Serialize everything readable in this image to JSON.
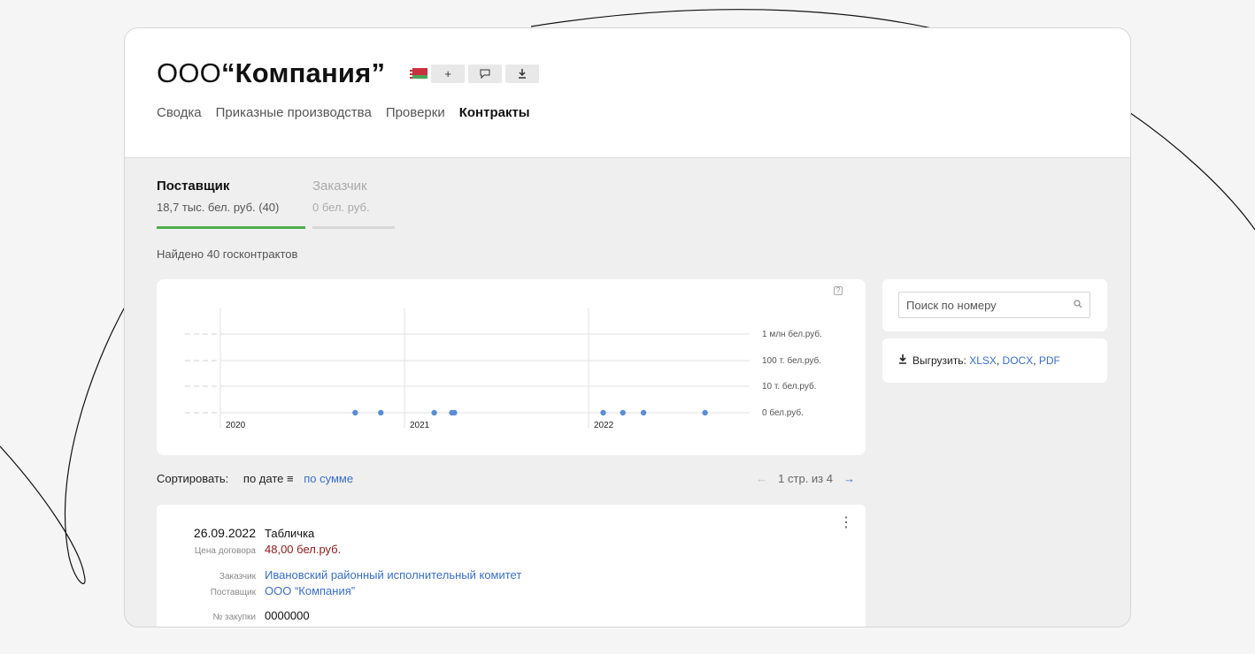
{
  "header": {
    "title_prefix": "ООО",
    "title_name": "“Компания”",
    "flag_icon": "belarus-flag-icon",
    "toolbar": {
      "add_label": "+",
      "comment_label": "💬",
      "download_label": "⤓"
    }
  },
  "nav": {
    "tabs": [
      {
        "label": "Сводка"
      },
      {
        "label": "Приказные производства"
      },
      {
        "label": "Проверки"
      },
      {
        "label": "Контракты"
      }
    ],
    "active": "Контракты"
  },
  "role_tabs": [
    {
      "name": "Поставщик",
      "sum": "18,7 тыс. бел. руб. (40)"
    },
    {
      "name": "Заказчик",
      "sum": "0 бел. руб."
    }
  ],
  "found_text": "Найдено 40 госконтрактов",
  "chart_data": {
    "type": "scatter",
    "y_scale": "log",
    "y_ticks": [
      "1 млн бел.руб.",
      "100 т. бел.руб.",
      "10 т. бел.руб.",
      "0 бел.руб."
    ],
    "x_ticks": [
      "2020",
      "2021",
      "2022"
    ],
    "points": [
      {
        "x": "2020-09-25",
        "y": 0
      },
      {
        "x": "2020-11-15",
        "y": 0
      },
      {
        "x": "2021-03-01",
        "y": 0
      },
      {
        "x": "2021-04-05",
        "y": 0
      },
      {
        "x": "2021-04-10",
        "y": 0
      },
      {
        "x": "2022-01-30",
        "y": 0
      },
      {
        "x": "2022-03-10",
        "y": 0
      },
      {
        "x": "2022-04-20",
        "y": 0
      },
      {
        "x": "2022-08-20",
        "y": 0
      }
    ],
    "marker_color": "#5b8dd6"
  },
  "search": {
    "placeholder": "Поиск по номеру"
  },
  "export": {
    "label": "Выгрузить:",
    "formats": [
      "XLSX",
      "DOCX",
      "PDF"
    ]
  },
  "sort": {
    "label": "Сортировать:",
    "by_date": "по дате",
    "by_sum": "по сумме"
  },
  "pager": {
    "text": "1 стр. из 4"
  },
  "contract": {
    "date": "26.09.2022",
    "title": "Табличка",
    "price_label": "Цена договора",
    "price": "48,00 бел.руб.",
    "customer_label": "Заказчик",
    "customer": "Ивановский районный исполнительный комитет",
    "supplier_label": "Поставщик",
    "supplier": "ООО “Компания”",
    "purchase_label": "№ закупки",
    "purchase": "0000000"
  }
}
